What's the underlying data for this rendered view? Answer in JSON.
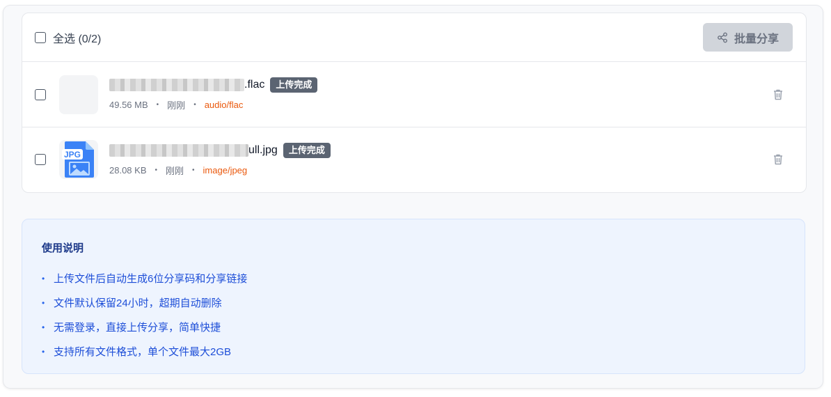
{
  "header": {
    "select_all_label": "全选 (0/2)",
    "share_button_label": "批量分享"
  },
  "files": [
    {
      "name_suffix": ".flac",
      "status": "上传完成",
      "size": "49.56 MB",
      "time": "刚刚",
      "mime": "audio/flac",
      "thumb_type": "blank"
    },
    {
      "name_suffix": "ull.jpg",
      "status": "上传完成",
      "size": "28.08 KB",
      "time": "刚刚",
      "mime": "image/jpeg",
      "thumb_type": "jpg-icon",
      "thumb_label": "JPG"
    }
  ],
  "separator": "•",
  "help": {
    "title": "使用说明",
    "items": [
      "上传文件后自动生成6位分享码和分享链接",
      "文件默认保留24小时，超期自动删除",
      "无需登录，直接上传分享，简单快捷",
      "支持所有文件格式，单个文件最大2GB"
    ],
    "bullet": "•"
  },
  "colors": {
    "badge": "#5b6472",
    "mime": "#ea580c",
    "help_text": "#1d4ed8",
    "help_bg": "#eef4fe"
  }
}
